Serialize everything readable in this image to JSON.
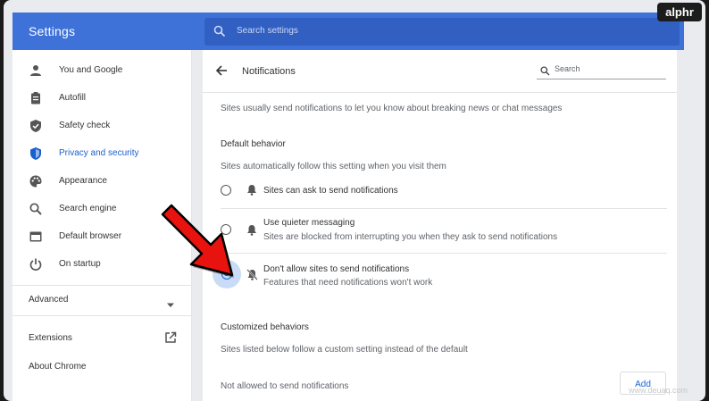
{
  "header": {
    "title": "Settings",
    "search_placeholder": "Search settings"
  },
  "sidebar": {
    "items": [
      {
        "label": "You and Google",
        "icon": "person-icon"
      },
      {
        "label": "Autofill",
        "icon": "clipboard-icon"
      },
      {
        "label": "Safety check",
        "icon": "shield-check-icon"
      },
      {
        "label": "Privacy and security",
        "icon": "shield-icon",
        "active": true
      },
      {
        "label": "Appearance",
        "icon": "palette-icon"
      },
      {
        "label": "Search engine",
        "icon": "search-icon"
      },
      {
        "label": "Default browser",
        "icon": "browser-window-icon"
      },
      {
        "label": "On startup",
        "icon": "power-icon"
      }
    ],
    "advanced_label": "Advanced",
    "extensions_label": "Extensions",
    "about_label": "About Chrome"
  },
  "main": {
    "title": "Notifications",
    "search_placeholder": "Search",
    "description": "Sites usually send notifications to let you know about breaking news or chat messages",
    "default_heading": "Default behavior",
    "default_sub": "Sites automatically follow this setting when you visit them",
    "options": [
      {
        "label": "Sites can ask to send notifications",
        "sublabel": "",
        "selected": false,
        "icon": "bell-icon"
      },
      {
        "label": "Use quieter messaging",
        "sublabel": "Sites are blocked from interrupting you when they ask to send notifications",
        "selected": false,
        "icon": "bell-icon"
      },
      {
        "label": "Don't allow sites to send notifications",
        "sublabel": "Features that need notifications won't work",
        "selected": true,
        "icon": "bell-off-icon"
      }
    ],
    "custom_heading": "Customized behaviors",
    "custom_sub": "Sites listed below follow a custom setting instead of the default",
    "not_allowed_label": "Not allowed to send notifications",
    "add_label": "Add"
  },
  "brand": {
    "logo": "alphr",
    "watermark": "www.deuaq.com"
  },
  "colors": {
    "header": "#3e72d9",
    "search_bar": "#315fc2",
    "accent": "#1a66d2",
    "arrow": "#e8130f"
  }
}
